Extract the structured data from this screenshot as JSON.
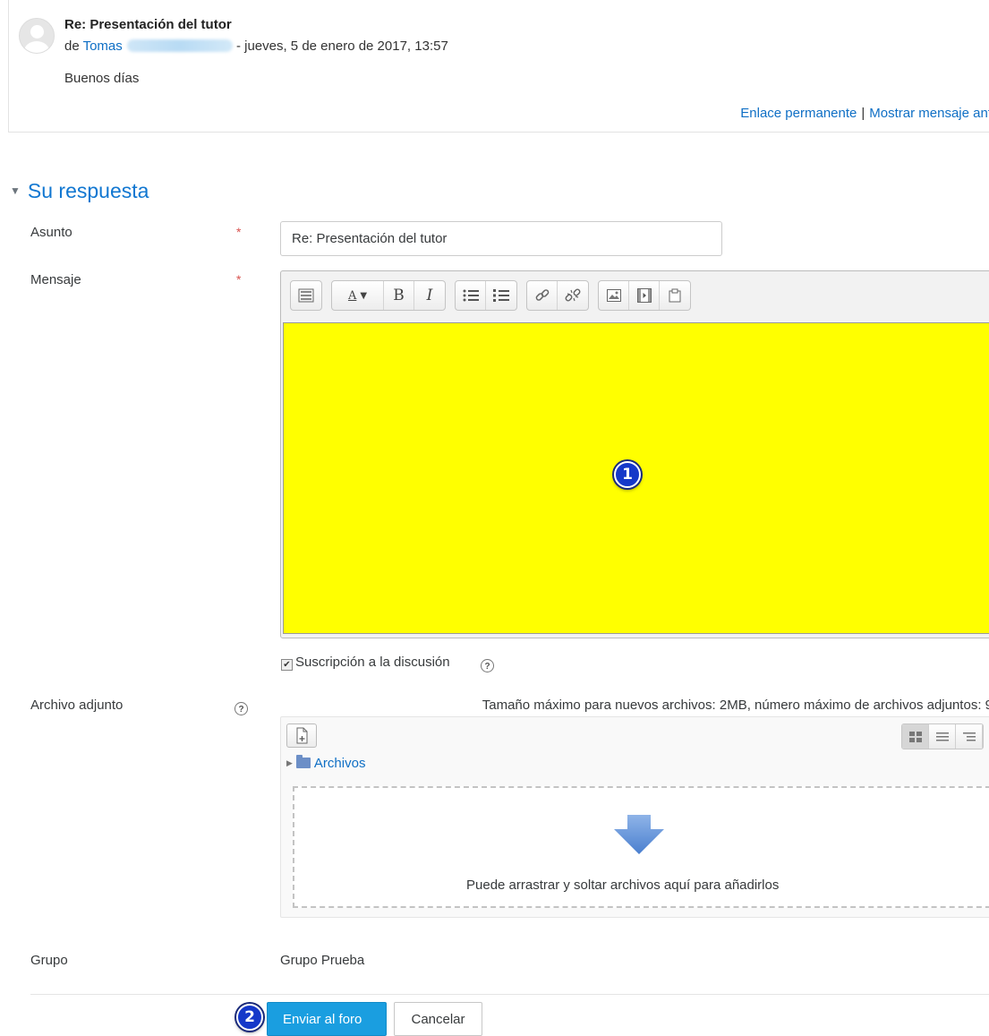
{
  "post": {
    "title": "Re: Presentación del tutor",
    "by_prefix": "de",
    "author": "Tomas",
    "date": "- jueves, 5 de enero de 2017, 13:57",
    "body": "Buenos días",
    "permalink_label": "Enlace permanente",
    "separator": "|",
    "show_parent_label": "Mostrar mensaje anterior"
  },
  "reply_section": {
    "heading": "Su respuesta",
    "subject_label": "Asunto",
    "subject_value": "Re: Presentación del tutor",
    "message_label": "Mensaje",
    "required_marker": "*",
    "subscription_label": "Suscripción a la discusión",
    "subscription_checked": true,
    "attachment_label": "Archivo adjunto",
    "attachment_limits": "Tamaño máximo para nuevos archivos: 2MB, número máximo de archivos adjuntos: 9",
    "folder_label": "Archivos",
    "dropzone_text": "Puede arrastrar y soltar archivos aquí para añadirlos",
    "group_label": "Grupo",
    "group_value": "Grupo Prueba",
    "help_icon_glyph": "?"
  },
  "editor": {
    "background_color": "#ffff00",
    "toolbar": {
      "style_label": "A",
      "bold_label": "B",
      "italic_label": "I"
    }
  },
  "markers": {
    "editor_marker": "1",
    "submit_marker": "2"
  },
  "actions": {
    "submit_label": "Enviar al foro",
    "cancel_label": "Cancelar"
  },
  "colors": {
    "link": "#0f6fc5",
    "heading": "#1177d1",
    "primary_button": "#1a9ee0",
    "required": "#d9534f",
    "marker": "#1538c9"
  }
}
